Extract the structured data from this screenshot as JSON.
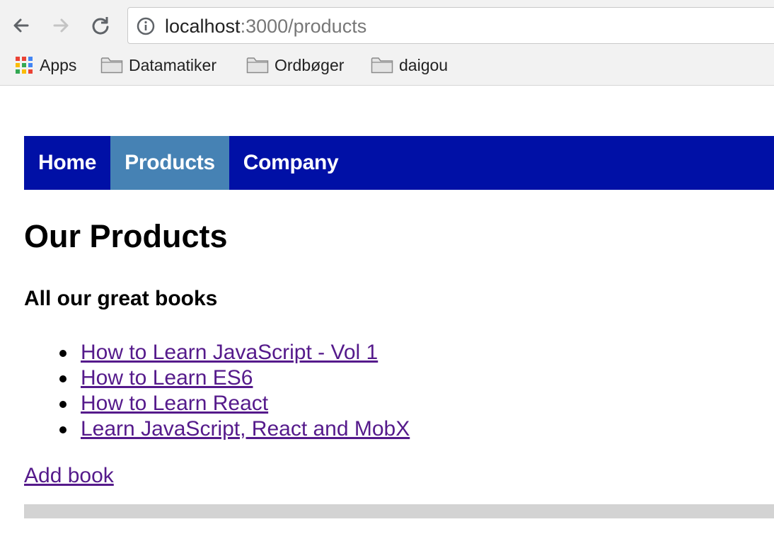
{
  "browser": {
    "back_icon": "arrow-left-icon",
    "forward_icon": "arrow-right-icon",
    "reload_icon": "reload-icon",
    "address": {
      "icon": "info-icon",
      "host": "localhost",
      "rest": ":3000/products"
    },
    "bookmarks": [
      {
        "label": "Apps",
        "icon": "apps-grid-icon"
      },
      {
        "label": "Datamatiker",
        "icon": "folder-icon"
      },
      {
        "label": "Ordbøger",
        "icon": "folder-icon"
      },
      {
        "label": "daigou",
        "icon": "folder-icon"
      }
    ]
  },
  "nav": {
    "items": [
      {
        "label": "Home",
        "active": false
      },
      {
        "label": "Products",
        "active": true
      },
      {
        "label": "Company",
        "active": false
      }
    ],
    "bar_color": "#0010a6",
    "active_color": "#4682b4"
  },
  "main": {
    "title": "Our Products",
    "subtitle": "All our great books",
    "books": [
      "How to Learn JavaScript - Vol 1",
      "How to Learn ES6",
      "How to Learn React",
      "Learn JavaScript, React and MobX"
    ],
    "add_link": "Add book",
    "link_color": "#551a8b"
  }
}
